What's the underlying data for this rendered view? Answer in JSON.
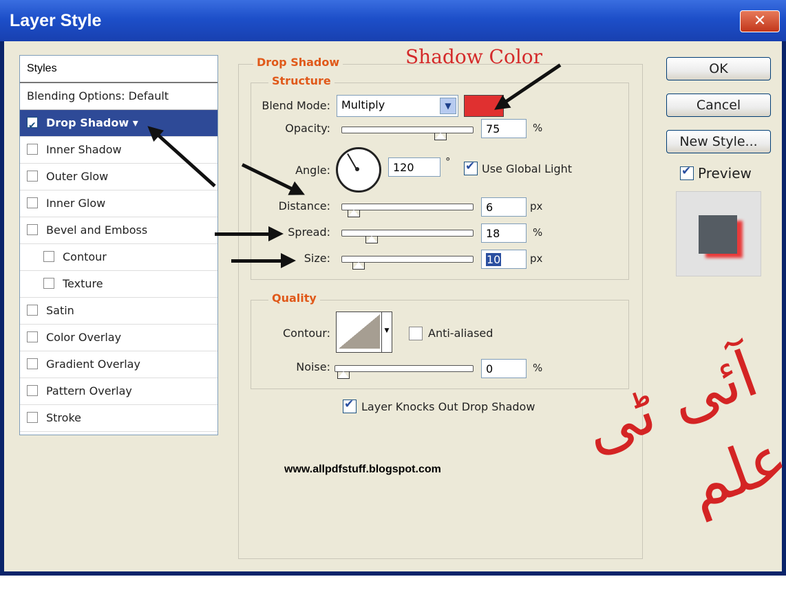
{
  "window": {
    "title": "Layer Style",
    "close_glyph": "✕"
  },
  "styles_list": {
    "header": "Styles",
    "blending": "Blending Options: Default",
    "items": [
      {
        "label": "Drop Shadow",
        "checked": true,
        "selected": true,
        "indent": false
      },
      {
        "label": "Inner Shadow",
        "checked": false,
        "indent": false
      },
      {
        "label": "Outer Glow",
        "checked": false,
        "indent": false
      },
      {
        "label": "Inner Glow",
        "checked": false,
        "indent": false
      },
      {
        "label": "Bevel and Emboss",
        "checked": false,
        "indent": false
      },
      {
        "label": "Contour",
        "checked": false,
        "indent": true
      },
      {
        "label": "Texture",
        "checked": false,
        "indent": true
      },
      {
        "label": "Satin",
        "checked": false,
        "indent": false
      },
      {
        "label": "Color Overlay",
        "checked": false,
        "indent": false
      },
      {
        "label": "Gradient Overlay",
        "checked": false,
        "indent": false
      },
      {
        "label": "Pattern Overlay",
        "checked": false,
        "indent": false
      },
      {
        "label": "Stroke",
        "checked": false,
        "indent": false
      }
    ]
  },
  "drop_shadow": {
    "title": "Drop Shadow",
    "structure": {
      "title": "Structure",
      "blend_mode_label": "Blend Mode:",
      "blend_mode_value": "Multiply",
      "shadow_color": "#e03030",
      "opacity_label": "Opacity:",
      "opacity_value": "75",
      "opacity_unit": "%",
      "opacity_level": 0.75,
      "angle_label": "Angle:",
      "angle_value": "120",
      "angle_unit": "°",
      "use_global_light": "Use Global Light",
      "distance_label": "Distance:",
      "distance_value": "6",
      "distance_unit": "px",
      "distance_level": 0.03,
      "spread_label": "Spread:",
      "spread_value": "18",
      "spread_unit": "%",
      "spread_level": 0.18,
      "size_label": "Size:",
      "size_value": "10",
      "size_unit": "px",
      "size_level": 0.07
    },
    "quality": {
      "title": "Quality",
      "contour_label": "Contour:",
      "anti_aliased": "Anti-aliased",
      "noise_label": "Noise:",
      "noise_value": "0",
      "noise_unit": "%",
      "noise_level": 0
    },
    "knockout_label": "Layer Knocks Out Drop Shadow"
  },
  "buttons": {
    "ok": "OK",
    "cancel": "Cancel",
    "new_style": "New Style...",
    "preview": "Preview"
  },
  "annotations": {
    "shadow_color_label": "Shadow Color",
    "website": "www.allpdfstuff.blogspot.com",
    "watermark": "آئی ٹی علم"
  }
}
